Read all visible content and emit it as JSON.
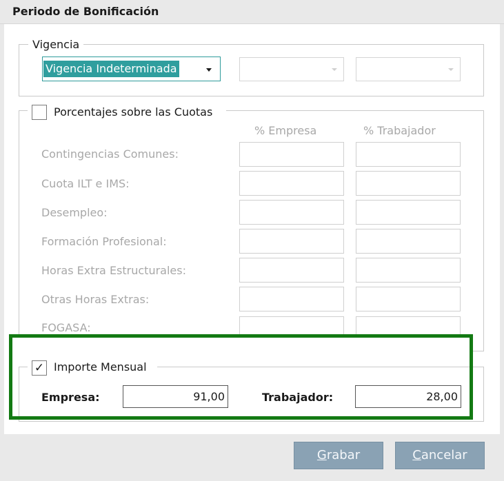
{
  "dialog": {
    "title": "Periodo de Bonificación"
  },
  "vigencia": {
    "legend": "Vigencia",
    "combo_value": "Vigencia Indeterminada"
  },
  "porcentajes": {
    "legend": "Porcentajes sobre las Cuotas",
    "checked": false,
    "col_empresa": "% Empresa",
    "col_trabajador": "% Trabajador",
    "rows": [
      "Contingencias Comunes:",
      "Cuota ILT e IMS:",
      "Desempleo:",
      "Formación Profesional:",
      "Horas Extra Estructurales:",
      "Otras Horas Extras:",
      "FOGASA:"
    ]
  },
  "importe": {
    "legend": "Importe Mensual",
    "checked": true,
    "check_glyph": "✓",
    "empresa_label": "Empresa:",
    "empresa_value": "91,00",
    "trabajador_label": "Trabajador:",
    "trabajador_value": "28,00"
  },
  "buttons": {
    "grabar_first": "G",
    "grabar_rest": "rabar",
    "cancelar_first": "C",
    "cancelar_rest": "ancelar"
  },
  "colors": {
    "highlight": "#137a13",
    "selection": "#2f9e9e",
    "button": "#8aa2b4"
  }
}
